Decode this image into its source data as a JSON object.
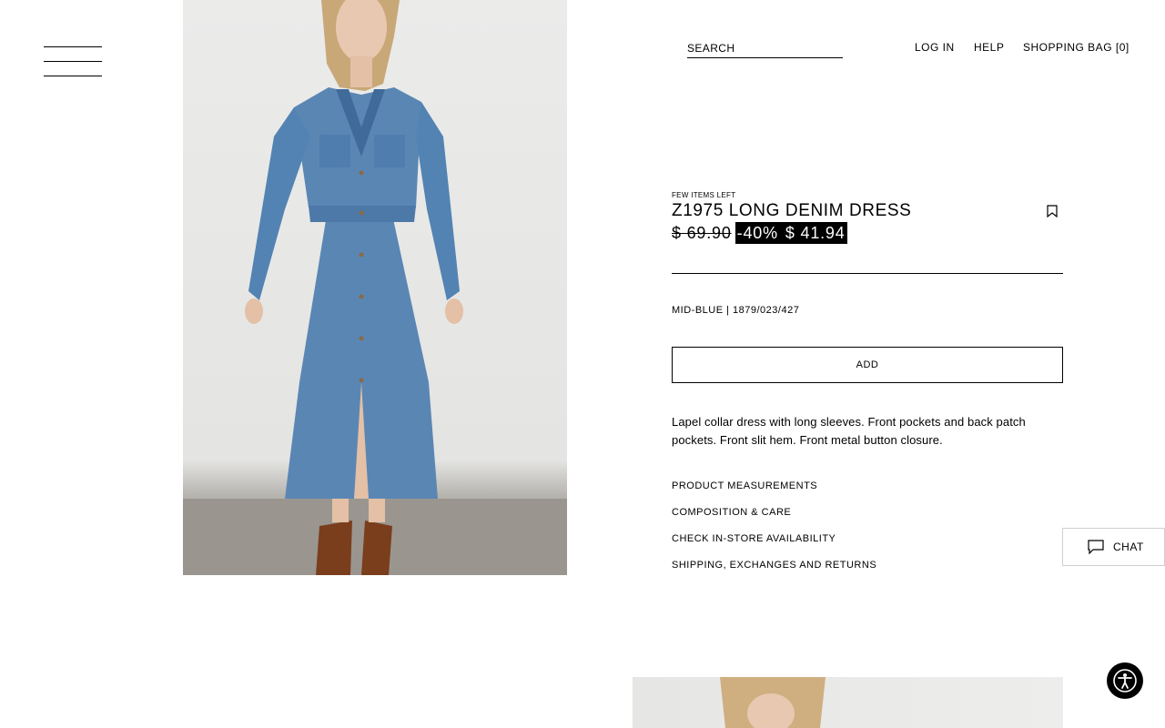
{
  "header": {
    "search_placeholder": "SEARCH",
    "login_label": "LOG IN",
    "help_label": "HELP",
    "bag_label": "SHOPPING BAG [0]"
  },
  "product": {
    "stock_note": "FEW ITEMS LEFT",
    "name": "Z1975 LONG DENIM DRESS",
    "original_price": "$ 69.90",
    "discount": "-40%",
    "sale_price": "$ 41.94",
    "color_ref": "MID-BLUE | 1879/023/427",
    "add_label": "ADD",
    "description": "Lapel collar dress with long sleeves. Front pockets and back patch pockets. Front slit hem. Front metal button closure."
  },
  "info_links": [
    "PRODUCT MEASUREMENTS",
    "COMPOSITION & CARE",
    "CHECK IN-STORE AVAILABILITY",
    "SHIPPING, EXCHANGES AND RETURNS"
  ],
  "chat_label": "CHAT",
  "icons": {
    "menu": "hamburger-icon",
    "bookmark": "bookmark-icon",
    "chat": "chat-bubble-icon",
    "accessibility": "accessibility-icon"
  },
  "colors": {
    "text": "#000000",
    "background": "#ffffff",
    "sale_background": "#000000",
    "sale_text": "#ffffff",
    "denim": "#5a86b4"
  }
}
